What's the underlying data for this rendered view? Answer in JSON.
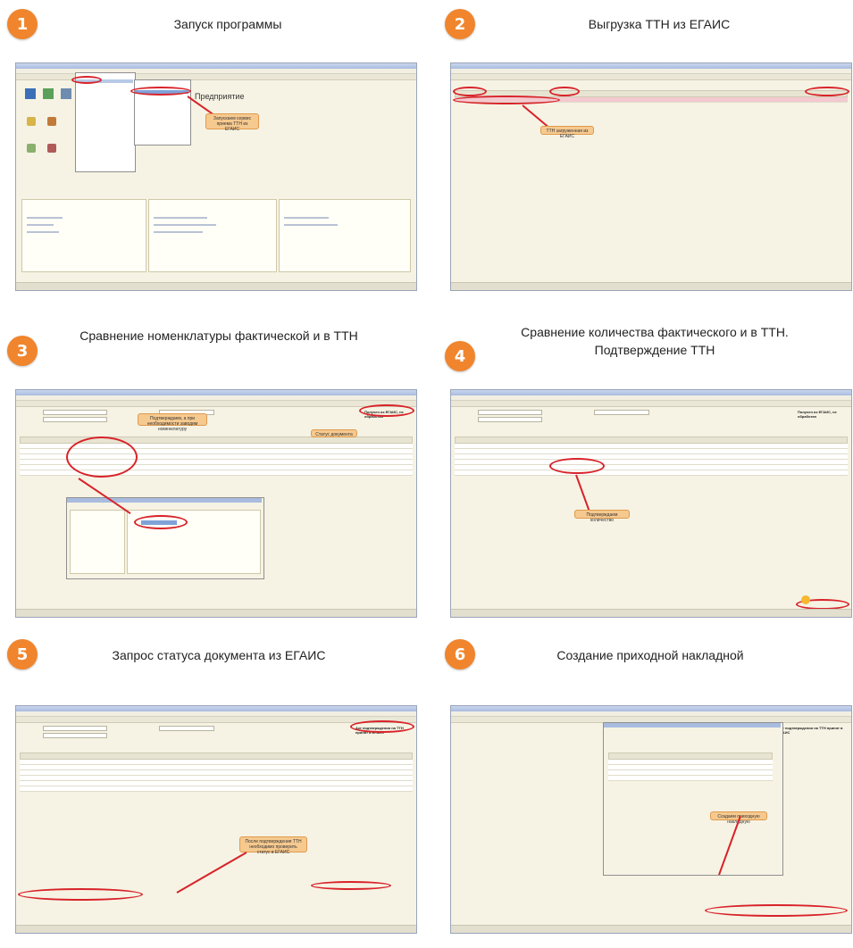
{
  "steps": [
    {
      "number": "1",
      "title": "Запуск программы"
    },
    {
      "number": "2",
      "title": "Выгрузка ТТН из ЕГАИС"
    },
    {
      "number": "3",
      "title": "Сравнение номенклатуры фактической и в ТТН"
    },
    {
      "number": "4",
      "title_line1": "Сравнение количества фактического и в ТТН.",
      "title_line2": "Подтверждение ТТН"
    },
    {
      "number": "5",
      "title": "Запрос статуса документа из ЕГАИС"
    },
    {
      "number": "6",
      "title": "Создание приходной накладной"
    }
  ],
  "screens": {
    "s1": {
      "heading": "Предприятие",
      "note": "Запускаем сервис приема ТТН из ЕГАИС"
    },
    "s2": {
      "note": "ТТН загруженная из ЕГАИС"
    },
    "s3": {
      "note_main": "Подтверждаем, а при необходимости заводим номенклатуру",
      "note_status": "Статус документа",
      "status_text": "Получен из ЕГАИС, не обработан"
    },
    "s4": {
      "note": "Подтверждаем количество",
      "status_text": "Получен из ЕГАИС, не обработан"
    },
    "s5": {
      "note": "После подтверждения ТТН необходимо проверить статус в ЕГАИС",
      "status_text": "Акт подтверждения на ТТН принят в ЕГАИС"
    },
    "s6": {
      "note": "Создаем приходную накладную",
      "status_text": "Акт подтверждения на ТТН принят в ЕГАИС"
    }
  },
  "colors": {
    "badge": "#f0852d",
    "annotation": "#f6c98f",
    "highlight_ring": "#d8232a"
  }
}
